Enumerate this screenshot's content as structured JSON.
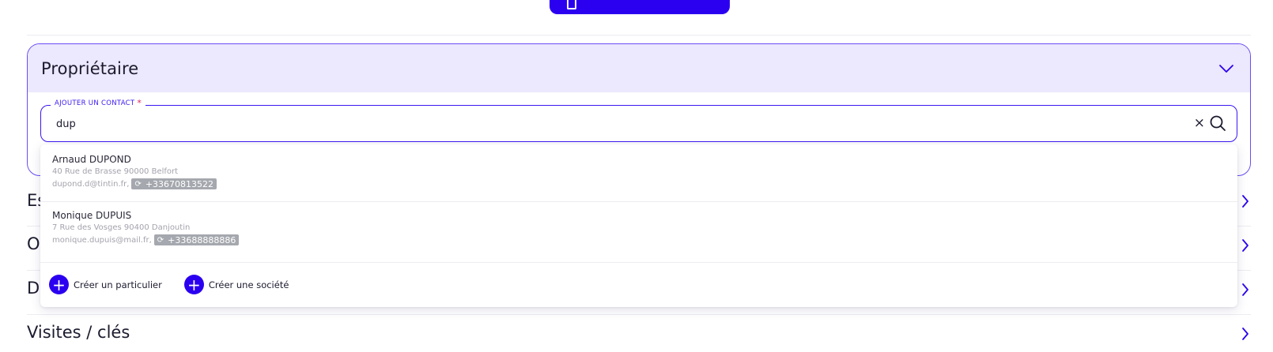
{
  "top_action": {
    "icon": "document-icon"
  },
  "owner_section": {
    "title": "Propriétaire",
    "toggle_icon": "chevron-down-icon",
    "contact_field": {
      "label": "AJOUTER UN CONTACT",
      "required_mark": "*",
      "value": "dup",
      "clear_symbol": "×"
    }
  },
  "suggestions": [
    {
      "name": "Arnaud DUPOND",
      "address": "40 Rue de Brasse 90000 Belfort",
      "email": "dupond.d@tintin.fr,",
      "phone": "+33670813522"
    },
    {
      "name": "Monique DUPUIS",
      "address": "7 Rue des Vosges 90400 Danjoutin",
      "email": "monique.dupuis@mail.fr,",
      "phone": "+33688888886"
    }
  ],
  "create_actions": [
    {
      "label": "Créer un particulier"
    },
    {
      "label": "Créer une société"
    }
  ],
  "collapsed_sections": [
    {
      "title": "Es"
    },
    {
      "title": "O"
    },
    {
      "title": "D"
    },
    {
      "title": "Visites / clés"
    }
  ],
  "accent_color": "#2b00f0"
}
